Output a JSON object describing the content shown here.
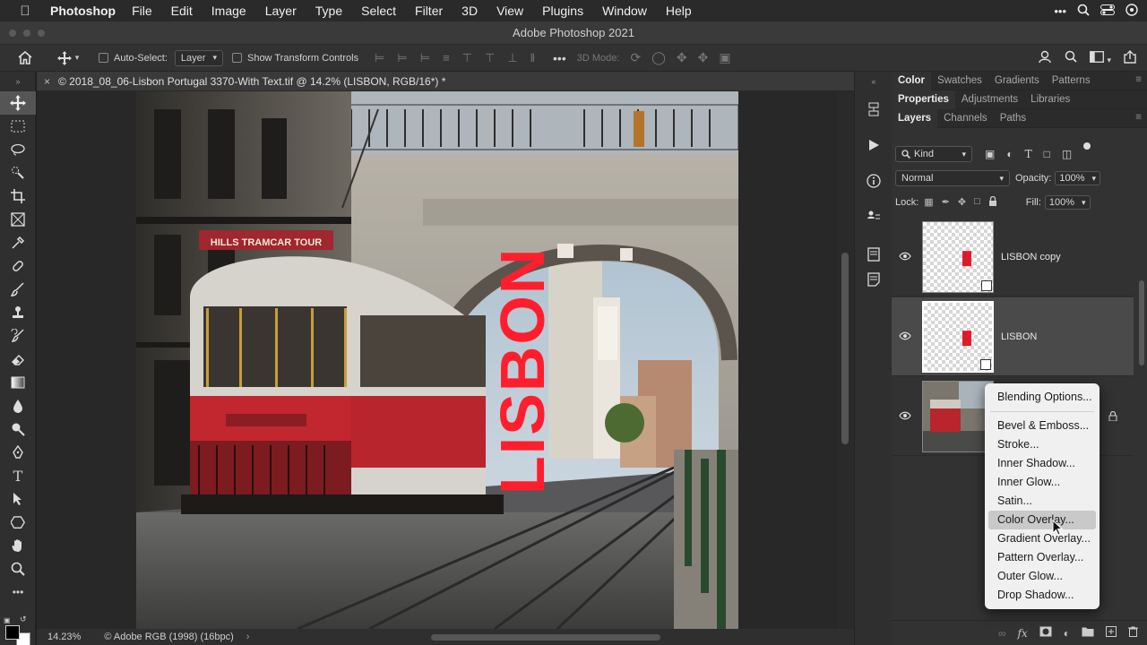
{
  "menubar": {
    "app": "Photoshop",
    "menus": [
      "File",
      "Edit",
      "Image",
      "Layer",
      "Type",
      "Select",
      "Filter",
      "3D",
      "View",
      "Plugins",
      "Window",
      "Help"
    ]
  },
  "window_title": "Adobe Photoshop 2021",
  "options_bar": {
    "auto_select_label": "Auto-Select:",
    "auto_select_value": "Layer",
    "show_transform_label": "Show Transform Controls",
    "mode_3d_label": "3D Mode:"
  },
  "document": {
    "tab_title": "© 2018_08_06-Lisbon Portugal 3370-With Text.tif @ 14.2% (LISBON, RGB/16*) *",
    "text_layer_content": "LISBON",
    "tram_sign": "HILLS TRAMCAR TOUR"
  },
  "status": {
    "zoom": "14.23%",
    "profile": "© Adobe RGB (1998) (16bpc)"
  },
  "panels": {
    "row1_tabs": [
      "Color",
      "Swatches",
      "Gradients",
      "Patterns"
    ],
    "row2_tabs": [
      "Properties",
      "Adjustments",
      "Libraries"
    ],
    "row3_tabs": [
      "Layers",
      "Channels",
      "Paths"
    ],
    "filter_kind": "Kind",
    "blend_mode": "Normal",
    "opacity_label": "Opacity:",
    "opacity_value": "100%",
    "lock_label": "Lock:",
    "fill_label": "Fill:",
    "fill_value": "100%"
  },
  "layers": [
    {
      "name": "LISBON copy",
      "visible": true,
      "selected": false
    },
    {
      "name": "LISBON",
      "visible": true,
      "selected": true
    },
    {
      "name": "",
      "visible": true,
      "selected": false,
      "locked": true
    }
  ],
  "context_menu": {
    "items": [
      "Blending Options...",
      "Bevel & Emboss...",
      "Stroke...",
      "Inner Shadow...",
      "Inner Glow...",
      "Satin...",
      "Color Overlay...",
      "Gradient Overlay...",
      "Pattern Overlay...",
      "Outer Glow...",
      "Drop Shadow..."
    ],
    "highlighted": "Color Overlay..."
  },
  "colors": {
    "accent_red": "#ff1e2d",
    "tram_red": "#b8252c",
    "panel_bg": "#323232"
  }
}
